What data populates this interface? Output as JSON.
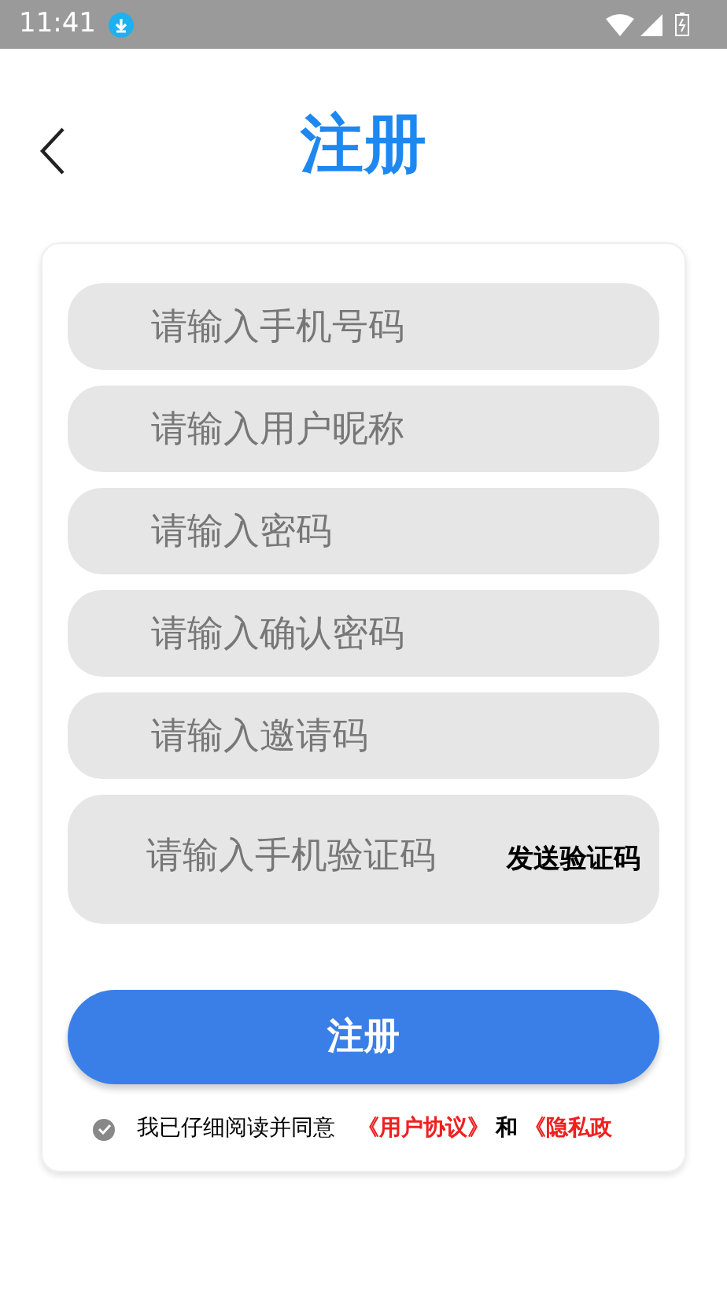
{
  "status_bar": {
    "time": "11:41"
  },
  "header": {
    "title": "注册"
  },
  "fields": [
    {
      "placeholder": "请输入手机号码"
    },
    {
      "placeholder": "请输入用户昵称"
    },
    {
      "placeholder": "请输入密码"
    },
    {
      "placeholder": "请输入确认密码"
    },
    {
      "placeholder": "请输入邀请码"
    }
  ],
  "verify": {
    "placeholder": "请输入手机验证码",
    "button": "发送验证码"
  },
  "submit": "注册",
  "agreement": {
    "checked": true,
    "text": "我已仔细阅读并同意",
    "links": [
      "《用户协议》",
      "《隐私政"
    ],
    "joiner": "和"
  }
}
